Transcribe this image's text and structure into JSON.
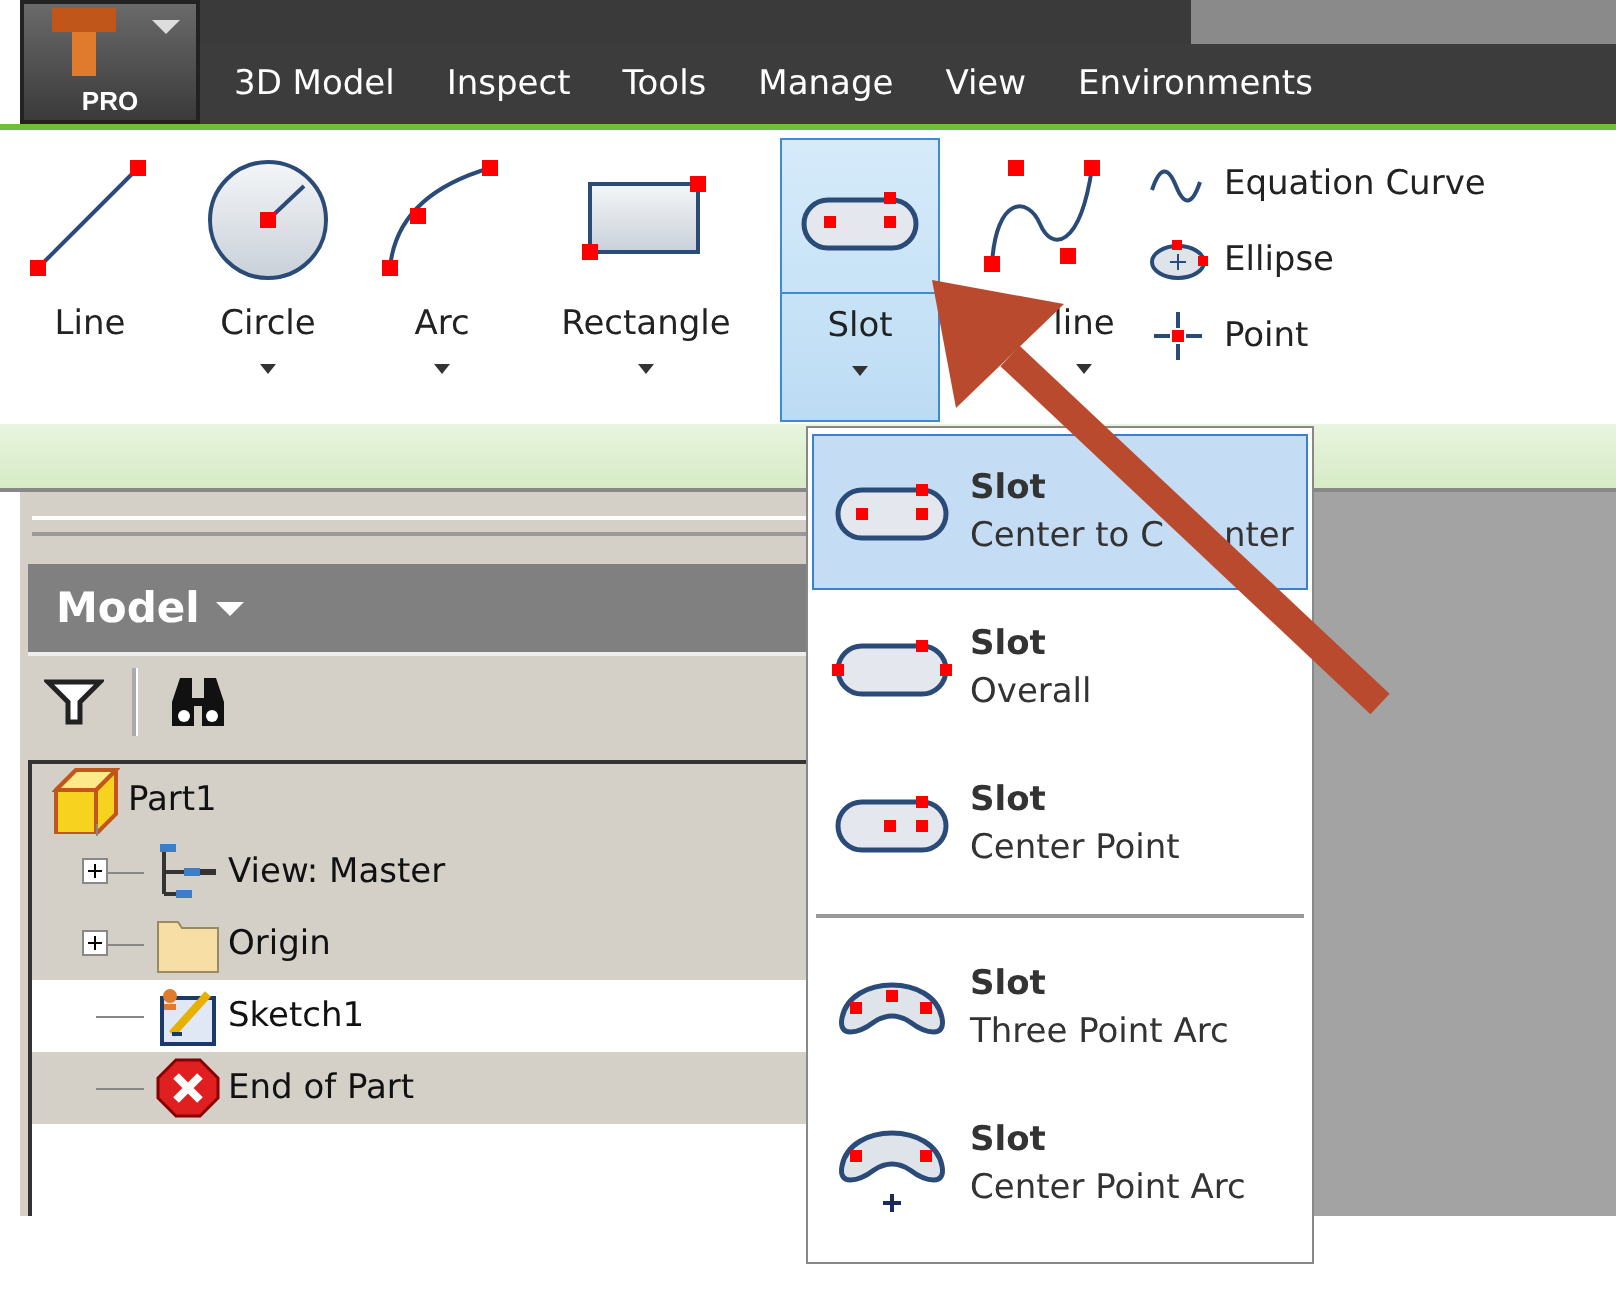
{
  "app_button": {
    "label": "PRO"
  },
  "tabs": [
    {
      "label": "3D Model"
    },
    {
      "label": "Inspect"
    },
    {
      "label": "Tools"
    },
    {
      "label": "Manage"
    },
    {
      "label": "View"
    },
    {
      "label": "Environments"
    }
  ],
  "ribbon": {
    "tools": [
      {
        "label": "Line",
        "kind": "line",
        "has_dropdown": false,
        "selected": false
      },
      {
        "label": "Circle",
        "kind": "circle",
        "has_dropdown": true,
        "selected": false
      },
      {
        "label": "Arc",
        "kind": "arc",
        "has_dropdown": true,
        "selected": false
      },
      {
        "label": "Rectangle",
        "kind": "rectangle",
        "has_dropdown": true,
        "selected": false
      },
      {
        "label": "Slot",
        "kind": "slot",
        "has_dropdown": true,
        "selected": true
      },
      {
        "label": "line",
        "kind": "spline",
        "has_dropdown": true,
        "selected": false
      }
    ],
    "small_tools": [
      {
        "label": "Equation Curve",
        "kind": "equation"
      },
      {
        "label": "Ellipse",
        "kind": "ellipse"
      },
      {
        "label": "Point",
        "kind": "point"
      }
    ]
  },
  "slot_menu": {
    "items": [
      {
        "title": "Slot",
        "subtitle": "Center to C",
        "subtitle_tail": "nter",
        "kind": "center-to-center",
        "selected": true,
        "separator_before": false
      },
      {
        "title": "Slot",
        "subtitle": "Overall",
        "kind": "overall",
        "selected": false,
        "separator_before": false
      },
      {
        "title": "Slot",
        "subtitle": "Center Point",
        "kind": "center-point",
        "selected": false,
        "separator_before": false
      },
      {
        "title": "Slot",
        "subtitle": "Three Point Arc",
        "kind": "three-point-arc",
        "selected": false,
        "separator_before": true
      },
      {
        "title": "Slot",
        "subtitle": "Center Point Arc",
        "kind": "center-point-arc",
        "selected": false,
        "separator_before": false
      }
    ]
  },
  "browser": {
    "title": "Model",
    "tree": [
      {
        "label": "Part1",
        "kind": "part",
        "highlighted": true,
        "children": [
          {
            "label": "View: Master",
            "kind": "view",
            "expandable": true,
            "highlighted": true
          },
          {
            "label": "Origin",
            "kind": "folder",
            "expandable": true,
            "highlighted": true
          },
          {
            "label": "Sketch1",
            "kind": "sketch",
            "expandable": false,
            "highlighted": false
          },
          {
            "label": "End of Part",
            "kind": "end",
            "expandable": false,
            "highlighted": true
          }
        ]
      }
    ]
  }
}
